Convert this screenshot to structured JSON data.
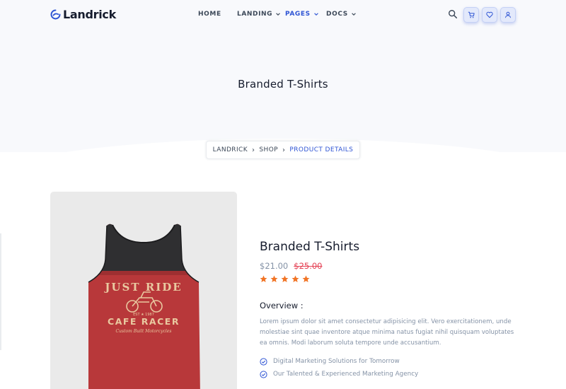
{
  "brand": {
    "name": "Landrick",
    "logo_icon": "landrick-logo-icon"
  },
  "nav": {
    "items": [
      {
        "label": "HOME",
        "has_dropdown": false,
        "active": false
      },
      {
        "label": "LANDING",
        "has_dropdown": true,
        "active": false
      },
      {
        "label": "PAGES",
        "has_dropdown": true,
        "active": true
      },
      {
        "label": "DOCS",
        "has_dropdown": true,
        "active": false
      }
    ],
    "icons": [
      "search-icon",
      "shopping-cart-icon",
      "heart-icon",
      "user-icon"
    ]
  },
  "hero": {
    "title": "Branded T-Shirts"
  },
  "breadcrumb": {
    "items": [
      "LANDRICK",
      "SHOP",
      "PRODUCT DETAILS"
    ]
  },
  "product": {
    "image": {
      "icon": "tank-top-product-image",
      "print_top": "JUST RIDE",
      "print_bottom": "CAFE RACER",
      "print_small": "Custom Built Motorcycles",
      "print_est": "EST ★ 1987"
    },
    "title": "Branded T-Shirts",
    "price_current": "$21.00",
    "price_old": "$25.00",
    "rating": 5,
    "overview_title": "Overview :",
    "overview_text": "Lorem ipsum dolor sit amet consectetur adipisicing elit. Vero exercitationem, unde molestiae sint quae inventore atque minima natus fugiat nihil quisquam voluptates ea omnis. Modi laborum soluta tempore unde accusantium.",
    "features": [
      "Digital Marketing Solutions for Tomorrow",
      "Our Talented & Experienced Marketing Agency"
    ]
  },
  "colors": {
    "primary": "#2f55d4",
    "heading": "#161c2d",
    "muted": "#8492a6",
    "danger": "#e43f52",
    "star": "#f17425",
    "hero_bg": "#f8f9fc"
  }
}
